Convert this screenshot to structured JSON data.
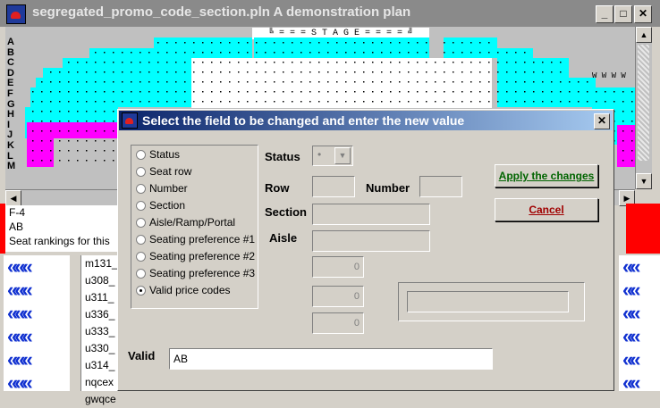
{
  "window": {
    "title": "segregated_promo_code_section.pln A demonstration plan",
    "minimize": "_",
    "maximize": "□",
    "close": "✕"
  },
  "seating": {
    "row_letters": [
      "A",
      "B",
      "C",
      "D",
      "E",
      "F",
      "G",
      "H",
      "I",
      "J",
      "K",
      "L",
      "M"
    ],
    "stage_label": "╚ = = = S T A G E = = = = ╝",
    "wheelchair_marks": "W  W   W  W",
    "colors": {
      "cyan": "#00ffff",
      "white": "#ffffff",
      "magenta": "#ff00ff",
      "gray": "#c0c0c0"
    }
  },
  "info": {
    "line1": "F-4",
    "line2": "AB",
    "line3": "Seat rankings for this"
  },
  "code_list": [
    "m131_",
    "u308_",
    "u311_",
    "u336_",
    "u333_",
    "u330_",
    "u314_",
    "nqcex",
    "gwqce"
  ],
  "dialog": {
    "title": "Select the field to be changed and enter the new value",
    "close": "✕",
    "options": [
      {
        "label": "Status",
        "selected": false
      },
      {
        "label": "Seat row",
        "selected": false
      },
      {
        "label": "Number",
        "selected": false
      },
      {
        "label": "Section",
        "selected": false
      },
      {
        "label": "Aisle/Ramp/Portal",
        "selected": false
      },
      {
        "label": "Seating preference #1",
        "selected": false
      },
      {
        "label": "Seating preference #2",
        "selected": false
      },
      {
        "label": "Seating preference #3",
        "selected": false
      },
      {
        "label": "Valid price codes",
        "selected": true
      }
    ],
    "labels": {
      "status": "Status",
      "row": "Row",
      "number": "Number",
      "section": "Section",
      "aisle": "Aisle",
      "valid": "Valid"
    },
    "status_value": "•",
    "pref_values": [
      "0",
      "0",
      "0"
    ],
    "valid_value": "AB",
    "apply_label": "Apply the changes",
    "cancel_label": "Cancel",
    "colors": {
      "apply_text": "#006400",
      "cancel_text": "#a00000"
    }
  }
}
